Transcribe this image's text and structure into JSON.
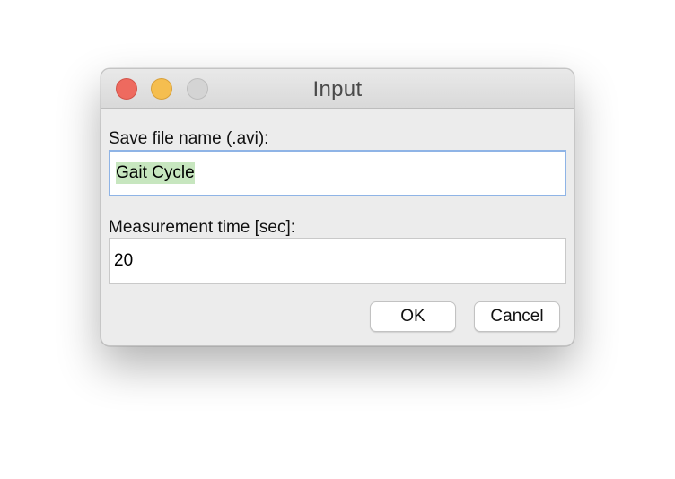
{
  "window": {
    "title": "Input",
    "controls": {
      "close_icon": "close-icon",
      "minimize_icon": "minimize-icon",
      "zoom_icon": "zoom-icon",
      "close_color": "#ee6a5f",
      "minimize_color": "#f5be4f",
      "zoom_color": "#d4d4d4"
    }
  },
  "form": {
    "filename_label": "Save file name (.avi):",
    "filename_value": "Gait Cycle",
    "time_label": "Measurement time [sec]:",
    "time_value": "20"
  },
  "buttons": {
    "ok_label": "OK",
    "cancel_label": "Cancel"
  },
  "colors": {
    "focus_ring": "#8fb4e6",
    "selection": "#c7e6bf"
  }
}
